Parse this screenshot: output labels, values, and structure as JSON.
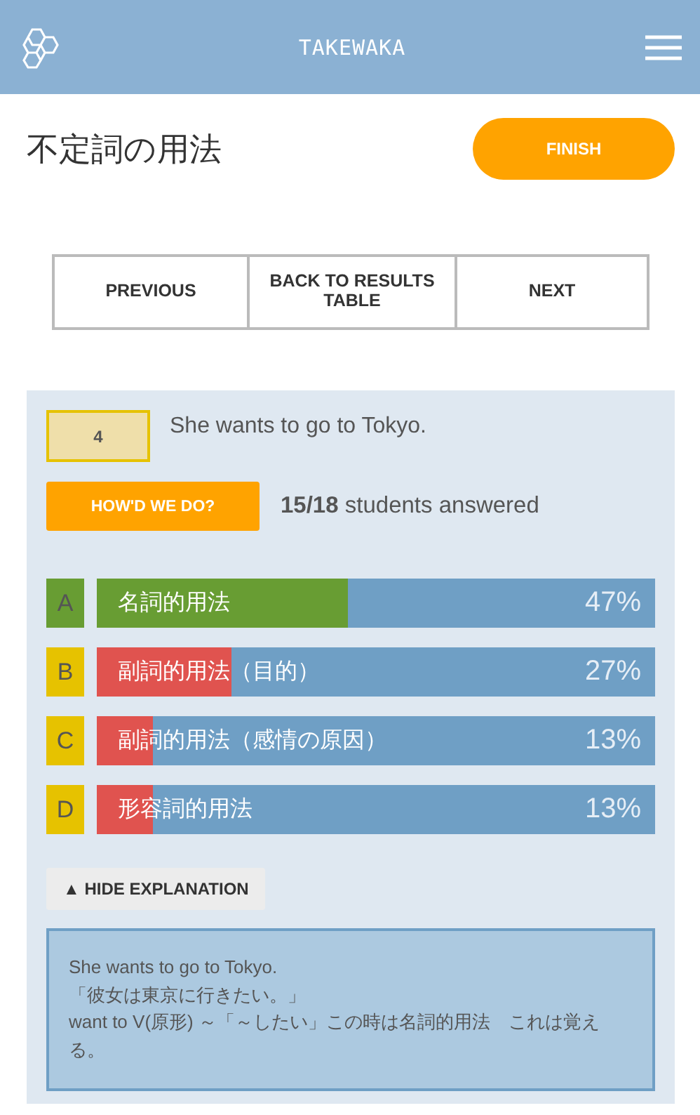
{
  "header": {
    "brand": "TAKEWAKA"
  },
  "title": "不定詞の用法",
  "finish_button": "FINISH",
  "nav": [
    "PREVIOUS",
    "BACK TO RESULTS TABLE",
    "NEXT"
  ],
  "question": {
    "number": "4",
    "text": "She wants to go to Tokyo."
  },
  "results_button": "HOW'D WE DO?",
  "answered": "**15/18** students answered",
  "options": [
    {
      "letter": "A",
      "label": "名詞的用法",
      "percent": "47%",
      "correct": true,
      "level": 0.45
    },
    {
      "letter": "B",
      "label": "副詞的用法（目的）",
      "percent": "27%",
      "correct": false,
      "level": 0.24
    },
    {
      "letter": "C",
      "label": "副詞的用法（感情の原因）",
      "percent": "13%",
      "correct": false,
      "level": 0.1
    },
    {
      "letter": "D",
      "label": "形容詞的用法",
      "percent": "13%",
      "correct": false,
      "level": 0.1
    }
  ],
  "explanation_toggle": "▲ HIDE EXPLANATION",
  "explanation": [
    "She wants to go to Tokyo.",
    "「彼女は東京に行きたい。」",
    "want to V(原形) ～「～したい」この時は名詞的用法　これは覚える。"
  ]
}
